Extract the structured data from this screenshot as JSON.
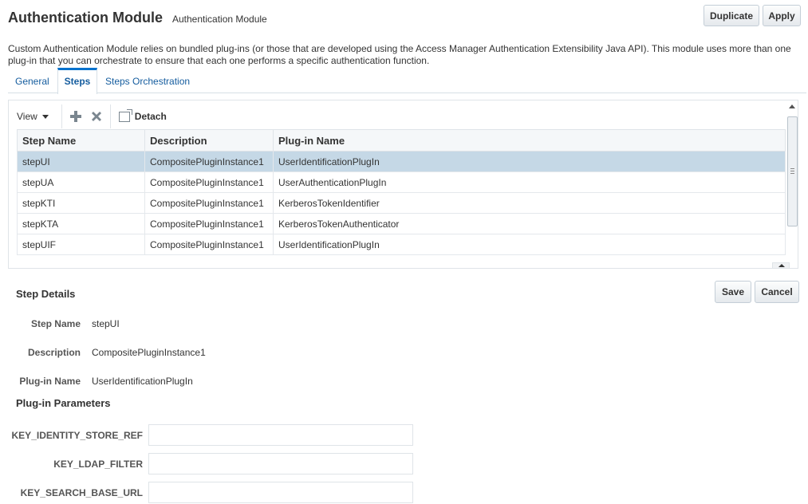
{
  "header": {
    "title": "Authentication Module",
    "subtitle": "Authentication Module",
    "duplicate_label": "Duplicate",
    "apply_label": "Apply"
  },
  "description": "Custom Authentication Module relies on bundled plug-ins (or those that are developed using the Access Manager Authentication Extensibility Java API). This module uses more than one plug-in that you can orchestrate to ensure that each one performs a specific authentication function.",
  "tabs": [
    {
      "label": "General",
      "selected": false
    },
    {
      "label": "Steps",
      "selected": true
    },
    {
      "label": "Steps Orchestration",
      "selected": false
    }
  ],
  "toolbar": {
    "view_label": "View",
    "add_icon": "plus-icon",
    "delete_icon": "close-icon",
    "detach_label": "Detach"
  },
  "table": {
    "columns": [
      "Step Name",
      "Description",
      "Plug-in Name"
    ],
    "rows": [
      {
        "step": "stepUI",
        "description": "CompositePluginInstance1",
        "plugin": "UserIdentificationPlugIn",
        "selected": true
      },
      {
        "step": "stepUA",
        "description": "CompositePluginInstance1",
        "plugin": "UserAuthenticationPlugIn",
        "selected": false
      },
      {
        "step": "stepKTI",
        "description": "CompositePluginInstance1",
        "plugin": "KerberosTokenIdentifier",
        "selected": false
      },
      {
        "step": "stepKTA",
        "description": "CompositePluginInstance1",
        "plugin": "KerberosTokenAuthenticator",
        "selected": false
      },
      {
        "step": "stepUIF",
        "description": "CompositePluginInstance1",
        "plugin": "UserIdentificationPlugIn",
        "selected": false
      }
    ]
  },
  "step_details": {
    "title": "Step Details",
    "save_label": "Save",
    "cancel_label": "Cancel",
    "fields": [
      {
        "label": "Step Name",
        "value": "stepUI"
      },
      {
        "label": "Description",
        "value": "CompositePluginInstance1"
      },
      {
        "label": "Plug-in Name",
        "value": "UserIdentificationPlugIn"
      }
    ]
  },
  "plugin_parameters": {
    "title": "Plug-in Parameters",
    "params": [
      {
        "label": "KEY_IDENTITY_STORE_REF",
        "value": ""
      },
      {
        "label": "KEY_LDAP_FILTER",
        "value": ""
      },
      {
        "label": "KEY_SEARCH_BASE_URL",
        "value": ""
      }
    ]
  },
  "colors": {
    "accent": "#0572ce",
    "link": "#145c9e",
    "selected_row": "#c5d8e6"
  }
}
